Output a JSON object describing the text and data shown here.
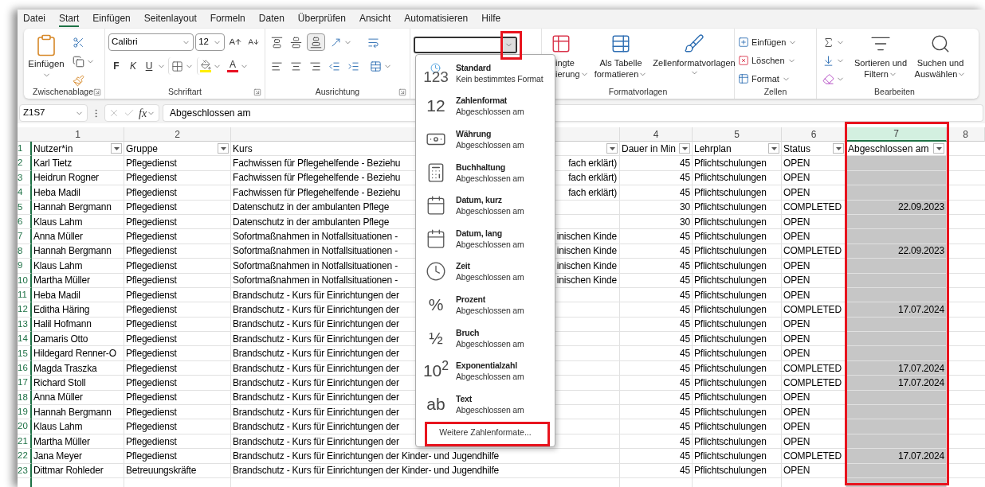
{
  "tabs": [
    {
      "label": "Datei",
      "selected": false
    },
    {
      "label": "Start",
      "selected": true
    },
    {
      "label": "Einfügen",
      "selected": false
    },
    {
      "label": "Seitenlayout",
      "selected": false
    },
    {
      "label": "Formeln",
      "selected": false
    },
    {
      "label": "Daten",
      "selected": false
    },
    {
      "label": "Überprüfen",
      "selected": false
    },
    {
      "label": "Ansicht",
      "selected": false
    },
    {
      "label": "Automatisieren",
      "selected": false
    },
    {
      "label": "Hilfe",
      "selected": false
    }
  ],
  "ribbon": {
    "clipboard": {
      "paste": "Einfügen",
      "label": "Zwischenablage"
    },
    "font": {
      "family": "Calibri",
      "size": "12",
      "bold": "F",
      "italic": "K",
      "underline": "U",
      "font_color": "A",
      "label": "Schriftart"
    },
    "alignment": {
      "label": "Ausrichtung"
    },
    "styles": {
      "conditional": [
        "ingte",
        "ierung"
      ],
      "table": [
        "Als Tabelle",
        "formatieren"
      ],
      "cell_styles": "Zellenformatvorlagen",
      "label": "Formatvorlagen"
    },
    "cells": {
      "items": [
        "Einfügen",
        "Löschen",
        "Format"
      ],
      "label": "Zellen"
    },
    "editing": {
      "sort": [
        "Sortieren und",
        "Filtern"
      ],
      "find": [
        "Suchen und",
        "Auswählen"
      ],
      "label": "Bearbeiten"
    }
  },
  "formula_bar": {
    "name_box": "Z1S7",
    "fx": "fx",
    "formula": "Abgeschlossen am"
  },
  "sheet": {
    "column_headers": [
      {
        "label": "1",
        "selected": false
      },
      {
        "label": "2",
        "selected": false
      },
      {
        "selected": false
      },
      {
        "label": "4",
        "selected": false
      },
      {
        "label": "5",
        "selected": false
      },
      {
        "label": "6",
        "selected": false
      },
      {
        "label": "7",
        "selected": true
      },
      {
        "label": "8",
        "selected": false
      }
    ],
    "header_row": {
      "number": "1",
      "cells": [
        "Nutzer*in",
        "Gruppe",
        "Kurs",
        "Dauer in Min",
        "Lehrplan",
        "Status",
        "Abgeschlossen am"
      ]
    },
    "rows": [
      {
        "number": "2",
        "user": "Karl Tietz",
        "group": "Pflegedienst",
        "course": "Fachwissen für Pflegehelfende - Beziehu",
        "course_end": "fach erklärt)",
        "minutes": "45",
        "plan": "Pflichtschulungen",
        "status": "OPEN"
      },
      {
        "number": "3",
        "user": "Heidrun Rogner",
        "group": "Pflegedienst",
        "course": "Fachwissen für Pflegehelfende - Beziehu",
        "course_end": "fach erklärt)",
        "minutes": "45",
        "plan": "Pflichtschulungen",
        "status": "OPEN"
      },
      {
        "number": "4",
        "user": "Heba Madil",
        "group": "Pflegedienst",
        "course": "Fachwissen für Pflegehelfende - Beziehu",
        "course_end": "fach erklärt)",
        "minutes": "45",
        "plan": "Pflichtschulungen",
        "status": "OPEN"
      },
      {
        "number": "5",
        "user": "Hannah Bergmann",
        "group": "Pflegedienst",
        "course": "Datenschutz in der ambulanten Pflege",
        "minutes": "30",
        "plan": "Pflichtschulungen",
        "status": "COMPLETED",
        "completed": "22.09.2023"
      },
      {
        "number": "6",
        "user": "Klaus Lahm",
        "group": "Pflegedienst",
        "course": "Datenschutz in der ambulanten Pflege",
        "minutes": "30",
        "plan": "Pflichtschulungen",
        "status": "OPEN"
      },
      {
        "number": "7",
        "user": "Anna Müller",
        "group": "Pflegedienst",
        "course": "Sofortmaßnahmen in Notfallsituationen -",
        "course_end": "inischen Kinde",
        "minutes": "45",
        "plan": "Pflichtschulungen",
        "status": "OPEN"
      },
      {
        "number": "8",
        "user": "Hannah Bergmann",
        "group": "Pflegedienst",
        "course": "Sofortmaßnahmen in Notfallsituationen -",
        "course_end": "inischen Kinde",
        "minutes": "45",
        "plan": "Pflichtschulungen",
        "status": "COMPLETED",
        "completed": "22.09.2023"
      },
      {
        "number": "9",
        "user": "Klaus Lahm",
        "group": "Pflegedienst",
        "course": "Sofortmaßnahmen in Notfallsituationen -",
        "course_end": "inischen Kinde",
        "minutes": "45",
        "plan": "Pflichtschulungen",
        "status": "OPEN"
      },
      {
        "number": "10",
        "user": "Martha  Müller",
        "group": "Pflegedienst",
        "course": "Sofortmaßnahmen in Notfallsituationen -",
        "course_end": "inischen Kinde",
        "minutes": "45",
        "plan": "Pflichtschulungen",
        "status": "OPEN"
      },
      {
        "number": "11",
        "user": "Heba Madil",
        "group": "Pflegedienst",
        "course": "Brandschutz - Kurs für Einrichtungen der",
        "minutes": "45",
        "plan": "Pflichtschulungen",
        "status": "OPEN"
      },
      {
        "number": "12",
        "user": "Editha Häring",
        "group": "Pflegedienst",
        "course": "Brandschutz - Kurs für Einrichtungen der",
        "minutes": "45",
        "plan": "Pflichtschulungen",
        "status": "COMPLETED",
        "completed": "17.07.2024"
      },
      {
        "number": "13",
        "user": "Halil Hofmann",
        "group": "Pflegedienst",
        "course": "Brandschutz - Kurs für Einrichtungen der",
        "minutes": "45",
        "plan": "Pflichtschulungen",
        "status": "OPEN"
      },
      {
        "number": "14",
        "user": "Damaris Otto",
        "group": "Pflegedienst",
        "course": "Brandschutz - Kurs für Einrichtungen der",
        "minutes": "45",
        "plan": "Pflichtschulungen",
        "status": "OPEN"
      },
      {
        "number": "15",
        "user": "Hildegard Renner-O",
        "group": "Pflegedienst",
        "course": "Brandschutz - Kurs für Einrichtungen der",
        "minutes": "45",
        "plan": "Pflichtschulungen",
        "status": "OPEN"
      },
      {
        "number": "16",
        "user": "Magda Traszka",
        "group": "Pflegedienst",
        "course": "Brandschutz - Kurs für Einrichtungen der",
        "minutes": "45",
        "plan": "Pflichtschulungen",
        "status": "COMPLETED",
        "completed": "17.07.2024"
      },
      {
        "number": "17",
        "user": "Richard Stoll",
        "group": "Pflegedienst",
        "course": "Brandschutz - Kurs für Einrichtungen der",
        "minutes": "45",
        "plan": "Pflichtschulungen",
        "status": "COMPLETED",
        "completed": "17.07.2024"
      },
      {
        "number": "18",
        "user": "Anna Müller",
        "group": "Pflegedienst",
        "course": "Brandschutz - Kurs für Einrichtungen der",
        "minutes": "45",
        "plan": "Pflichtschulungen",
        "status": "OPEN"
      },
      {
        "number": "19",
        "user": "Hannah Bergmann",
        "group": "Pflegedienst",
        "course": "Brandschutz - Kurs für Einrichtungen der",
        "minutes": "45",
        "plan": "Pflichtschulungen",
        "status": "OPEN"
      },
      {
        "number": "20",
        "user": "Klaus Lahm",
        "group": "Pflegedienst",
        "course": "Brandschutz - Kurs für Einrichtungen der",
        "minutes": "45",
        "plan": "Pflichtschulungen",
        "status": "OPEN"
      },
      {
        "number": "21",
        "user": "Martha  Müller",
        "group": "Pflegedienst",
        "course": "Brandschutz - Kurs für Einrichtungen der",
        "minutes": "45",
        "plan": "Pflichtschulungen",
        "status": "OPEN"
      },
      {
        "number": "22",
        "user": "Jana Meyer",
        "group": "Pflegedienst",
        "course": "Brandschutz - Kurs für Einrichtungen der Kinder- und Jugendhilfe",
        "minutes": "45",
        "plan": "Pflichtschulungen",
        "status": "COMPLETED",
        "completed": "17.07.2024"
      },
      {
        "number": "23",
        "user": "Dittmar Rohleder",
        "group": "Betreuungskräfte",
        "course": "Brandschutz - Kurs für Einrichtungen der Kinder- und Jugendhilfe",
        "minutes": "45",
        "plan": "Pflichtschulungen",
        "status": "OPEN"
      }
    ]
  },
  "number_format_menu": {
    "items": [
      {
        "kind": "clock_glyph",
        "glyph": "123",
        "title": "Standard",
        "subtitle": "Kein bestimmtes Format"
      },
      {
        "kind": "glyph",
        "glyph": "12",
        "title": "Zahlenformat",
        "subtitle": "Abgeschlossen am"
      },
      {
        "kind": "currency",
        "title": "Währung",
        "subtitle": "Abgeschlossen am"
      },
      {
        "kind": "calculator",
        "title": "Buchhaltung",
        "subtitle": "Abgeschlossen am"
      },
      {
        "kind": "calendar",
        "title": "Datum, kurz",
        "subtitle": "Abgeschlossen am"
      },
      {
        "kind": "calendar",
        "title": "Datum, lang",
        "subtitle": "Abgeschlossen am"
      },
      {
        "kind": "clock",
        "title": "Zeit",
        "subtitle": "Abgeschlossen am"
      },
      {
        "kind": "glyph",
        "glyph": "%",
        "title": "Prozent",
        "subtitle": "Abgeschlossen am"
      },
      {
        "kind": "glyph",
        "glyph": "½",
        "title": "Bruch",
        "subtitle": "Abgeschlossen am"
      },
      {
        "kind": "glyph",
        "glyph": "10$^{2}$",
        "title": "Exponentialzahl",
        "subtitle": "Abgeschlossen am"
      },
      {
        "kind": "glyph",
        "glyph": "ab",
        "title": "Text",
        "subtitle": "Abgeschlossen am"
      }
    ],
    "more": "Weitere Zahlenformate..."
  }
}
